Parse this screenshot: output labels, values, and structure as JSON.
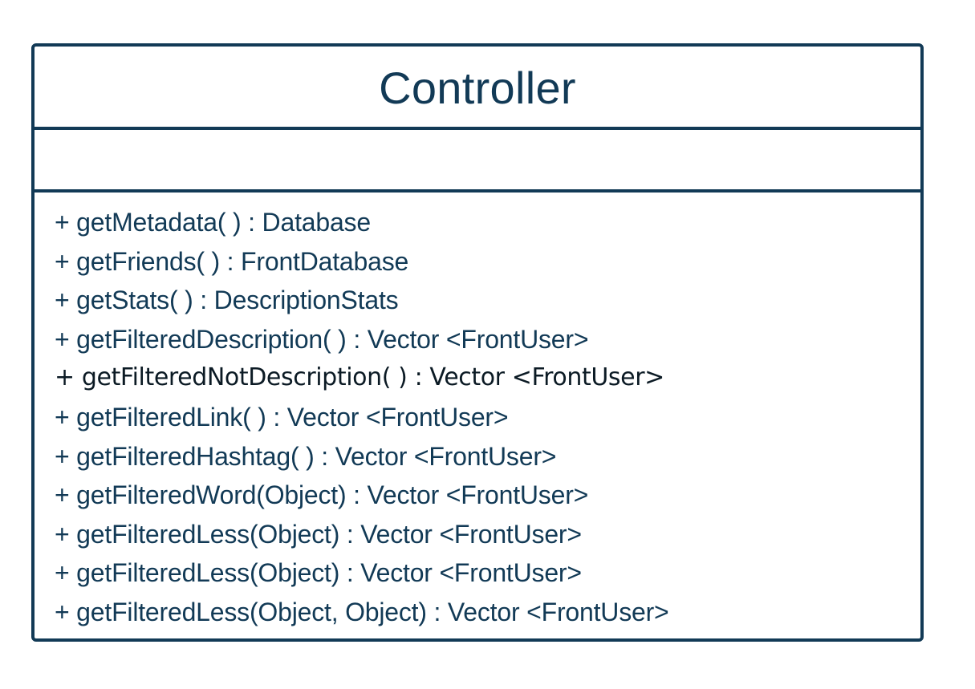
{
  "diagram": {
    "class_name": "Controller",
    "attributes": [],
    "operations": [
      "+ getMetadata( ) : Database",
      "+ getFriends( ) : FrontDatabase",
      "+ getStats( ) : DescriptionStats",
      "+ getFilteredDescription( ) : Vector <FrontUser>",
      "+ getFilteredNotDescription( ) : Vector <FrontUser>",
      "+ getFilteredLink( ) : Vector <FrontUser>",
      "+ getFilteredHashtag( ) : Vector <FrontUser>",
      "+ getFilteredWord(Object) : Vector <FrontUser>",
      "+ getFilteredLess(Object) : Vector <FrontUser>",
      "+ getFilteredLess(Object) : Vector <FrontUser>",
      "+ getFilteredLess(Object, Object) : Vector <FrontUser>"
    ]
  },
  "colors": {
    "border": "#123a56",
    "text": "#123a56",
    "alt_text": "#0b1a24",
    "background": "#ffffff"
  }
}
